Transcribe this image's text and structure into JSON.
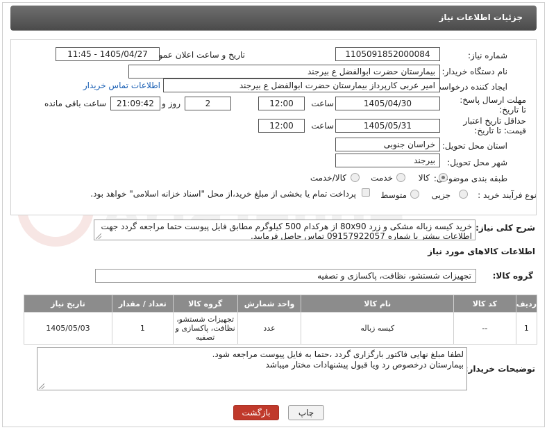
{
  "header": {
    "title": "جزئیات اطلاعات نیاز"
  },
  "fields": {
    "need_number_label": "شماره نیاز:",
    "need_number": "1105091852000084",
    "announce_label": "تاریخ و ساعت اعلان عمومی:",
    "announce_value": "1405/04/27 - 11:45",
    "buyer_org_label": "نام دستگاه خریدار:",
    "buyer_org": "بیمارستان حضرت ابوالفضل  ع  بیرجند",
    "requester_label": "ایجاد کننده درخواست:",
    "requester": "امیر عربی کارپرداز بیمارستان حضرت ابوالفضل  ع  بیرجند",
    "contact_link": "اطلاعات تماس خریدار",
    "reply_deadline_label": "مهلت ارسال پاسخ: تا تاریخ:",
    "reply_date": "1405/04/30",
    "time_label": "ساعت",
    "reply_time": "12:00",
    "days_value": "2",
    "days_label": "روز و",
    "remaining_time": "21:09:42",
    "remaining_label": "ساعت باقی مانده",
    "price_validity_label": "حداقل تاریخ اعتبار قیمت: تا تاریخ:",
    "price_date": "1405/05/31",
    "price_time": "12:00",
    "delivery_province_label": "استان محل تحویل:",
    "delivery_province": "خراسان جنوبی",
    "delivery_city_label": "شهر محل تحویل:",
    "delivery_city": "بیرجند",
    "category_label": "طبقه بندی موضوعی:",
    "category_options": [
      "کالا",
      "خدمت",
      "کالا/خدمت"
    ],
    "process_label": "نوع فرآیند خرید :",
    "process_options": [
      "جزیی",
      "متوسط"
    ],
    "payment_note": "پرداخت تمام یا بخشی از مبلغ خرید،از محل \"اسناد خزانه اسلامی\" خواهد بود."
  },
  "description": {
    "label": "شرح کلی نیاز:",
    "text": "خرید کیسه زباله مشکی و زرد 80x90  از هرکدام 500 کیلوگرم  مطابق فایل پیوست حتما مراجعه گردد جهت اطلاعات بیشتر با شماره 09157922057 تماس حاصل فرمایید."
  },
  "goods": {
    "section_title": "اطلاعات کالاهای مورد نیاز",
    "group_label": "گروه کالا:",
    "group_value": "تجهیزات شستشو، نظافت، پاکسازی و تصفیه",
    "columns": [
      "ردیف",
      "کد کالا",
      "نام کالا",
      "واحد شمارش",
      "گروه کالا",
      "تعداد / مقدار",
      "تاریخ نیاز"
    ],
    "rows": [
      [
        "1",
        "--",
        "کیسه زباله",
        "عدد",
        "تجهیزات شستشو، نظافت، پاکسازی و تصفیه",
        "1",
        "1405/05/03"
      ]
    ]
  },
  "buyer_notes": {
    "label": "توضیحات خریدار:",
    "line1": "لطفا مبلغ نهایی فاکتور بارگزاری گردد ،حتما به فایل پیوست مراجعه شود.",
    "line2": "بیمارستان درخصوص رد ویا قبول پیشنهادات مختار میباشد"
  },
  "buttons": {
    "print": "چاپ",
    "back": "بازگشت"
  },
  "watermark": {
    "text": "AriaTender.neT"
  },
  "colors": {
    "header": "#555555",
    "table_header": "#8c8c8c",
    "back_button": "#c0392b",
    "link": "#1a5fb4"
  }
}
